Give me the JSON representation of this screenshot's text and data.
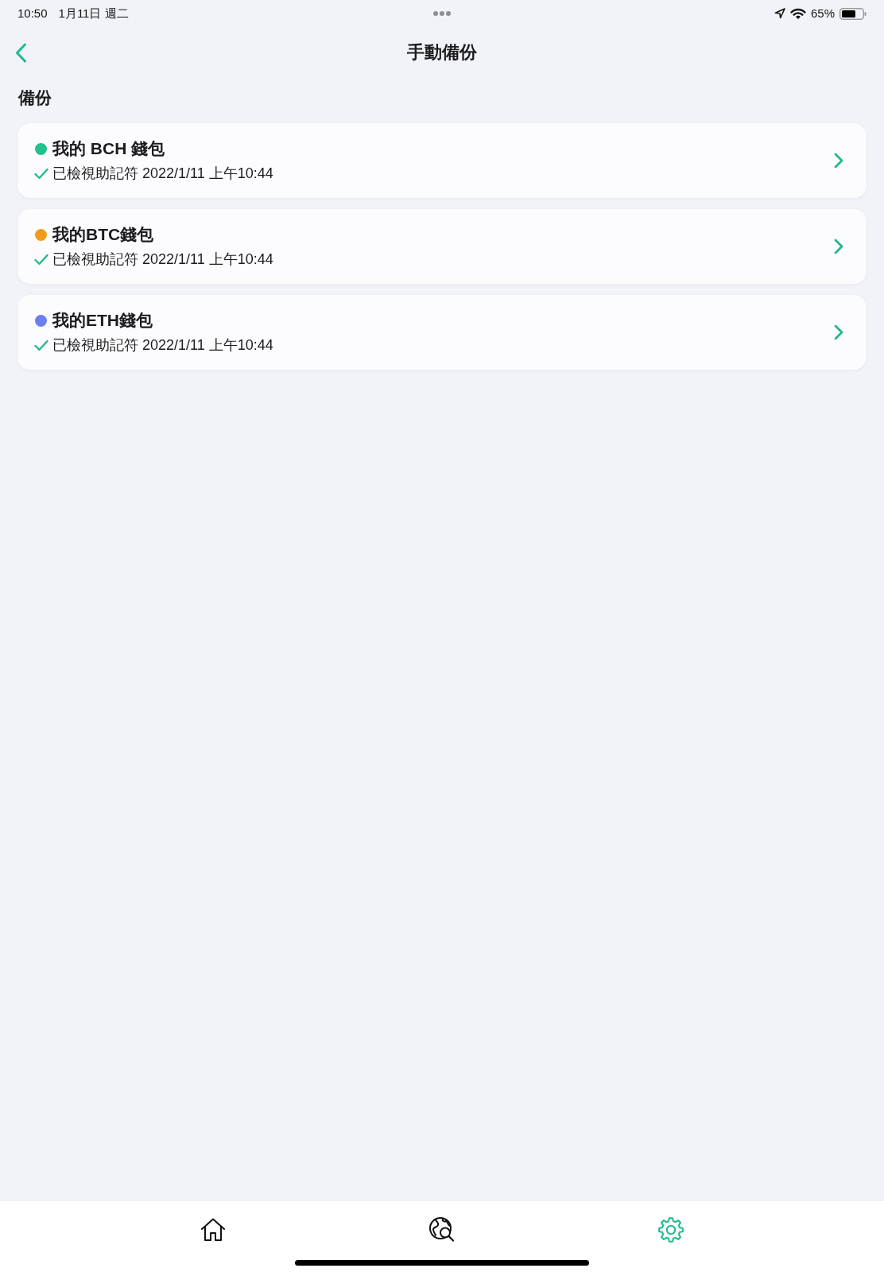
{
  "status_bar": {
    "time": "10:50",
    "date": "1月11日 週二",
    "battery": "65%"
  },
  "nav_bar": {
    "title": "手動備份"
  },
  "section": {
    "title": "備份"
  },
  "wallets": [
    {
      "name": "我的 BCH 錢包",
      "color": "#21c08d",
      "verified": true,
      "status": "已檢視助記符 2022/1/11 上午10:44"
    },
    {
      "name": "我的BTC錢包",
      "color": "#f09c1a",
      "verified": true,
      "status": "已檢視助記符 2022/1/11 上午10:44"
    },
    {
      "name": "我的ETH錢包",
      "color": "#6a80ef",
      "verified": true,
      "status": "已檢視助記符 2022/1/11 上午10:44"
    }
  ],
  "tab_bar": {
    "tabs": [
      {
        "kind": "home",
        "selected": false
      },
      {
        "kind": "explore",
        "selected": false
      },
      {
        "kind": "settings",
        "selected": true
      }
    ]
  }
}
